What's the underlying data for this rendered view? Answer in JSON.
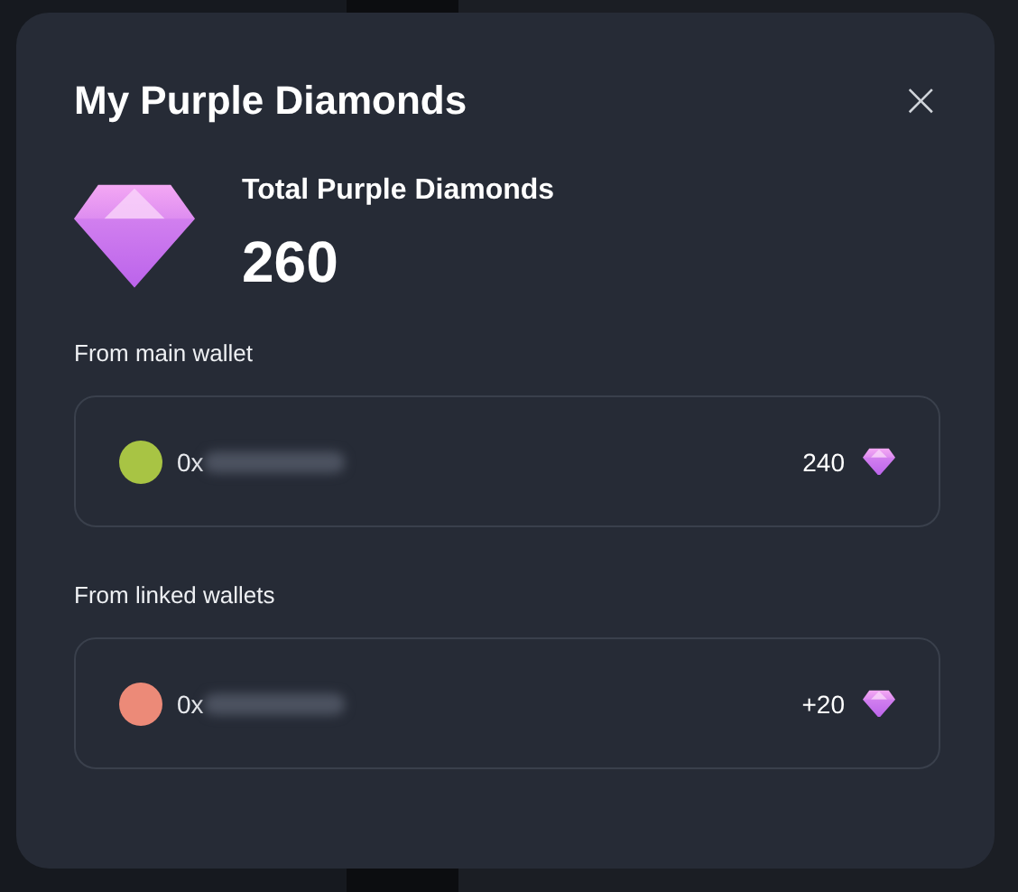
{
  "dialog": {
    "title": "My Purple Diamonds",
    "close": "×"
  },
  "total": {
    "label": "Total Purple Diamonds",
    "value": "260"
  },
  "sections": [
    {
      "heading": "From main wallet",
      "wallets": [
        {
          "address": "0x",
          "amount": "240",
          "color": "#a8c444"
        }
      ]
    },
    {
      "heading": "From linked wallets",
      "wallets": [
        {
          "address": "0x",
          "amount": "+20",
          "color": "#ec8a78"
        }
      ]
    }
  ]
}
